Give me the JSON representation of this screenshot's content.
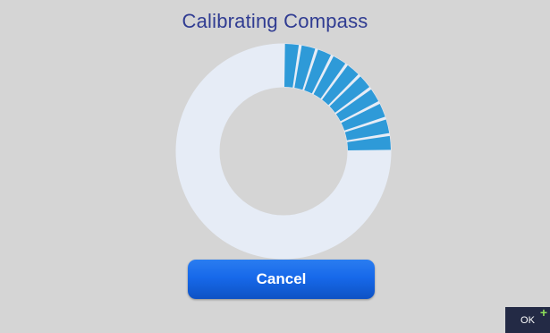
{
  "dialog": {
    "title": "Calibrating Compass"
  },
  "progress": {
    "segments_total": 40,
    "segments_filled": 10,
    "fraction": 0.25,
    "track_color": "#e6ecf6",
    "fill_color": "#2e9ad8"
  },
  "buttons": {
    "cancel_label": "Cancel",
    "ok_label": "OK",
    "ok_badge": "+"
  }
}
